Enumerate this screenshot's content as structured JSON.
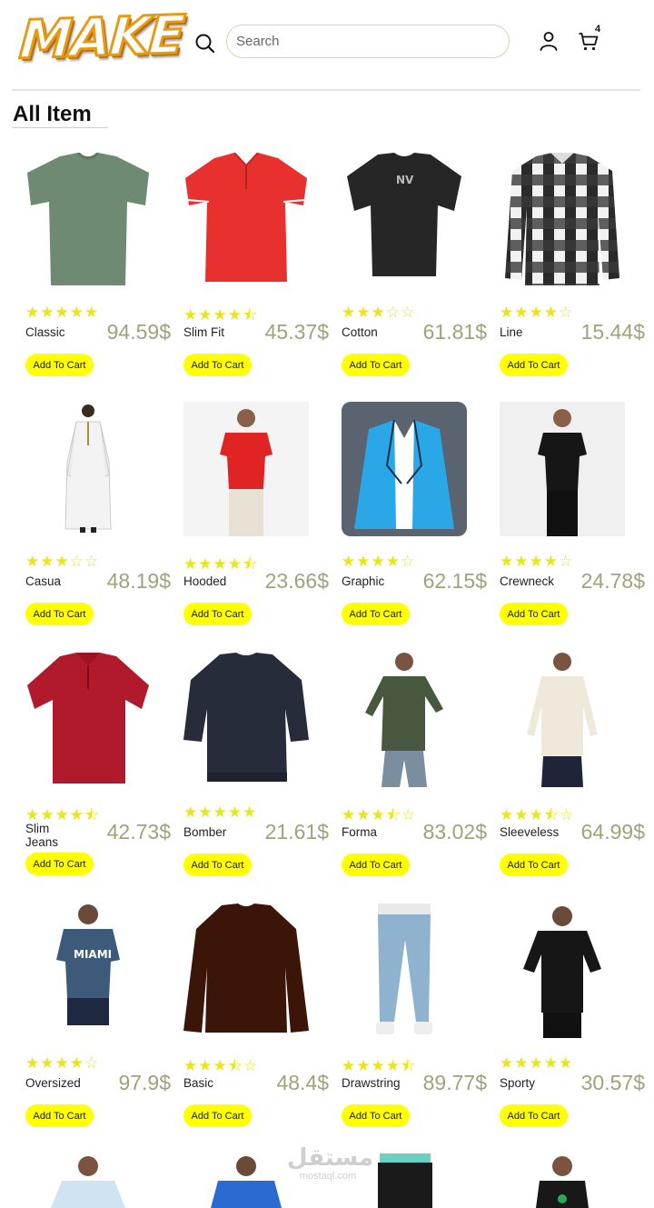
{
  "logo": {
    "text": "MAKE"
  },
  "header": {
    "search_placeholder": "Search",
    "cart_count": "4"
  },
  "section": {
    "title": "All Item"
  },
  "colors": {
    "accent_button": "#ffff00",
    "star": "#e6e619",
    "price": "#9fa27a"
  },
  "products": [
    {
      "name": "Classic",
      "price": "94.59$",
      "rating": 5,
      "button": "Add To Cart",
      "image": "green-tshirt"
    },
    {
      "name": "Slim Fit",
      "price": "45.37$",
      "rating": 4.5,
      "button": "Add To Cart",
      "image": "red-polo"
    },
    {
      "name": "Cotton",
      "price": "61.81$",
      "rating": 3,
      "button": "Add To Cart",
      "image": "black-oversize-tshirt"
    },
    {
      "name": "Line",
      "price": "15.44$",
      "rating": 4,
      "button": "Add To Cart",
      "image": "plaid-shirt"
    },
    {
      "name": "Casua",
      "price": "48.19$",
      "rating": 3,
      "button": "Add To Cart",
      "image": "white-thobe"
    },
    {
      "name": "Hooded",
      "price": "23.66$",
      "rating": 4.5,
      "button": "Add To Cart",
      "image": "man-red-polo"
    },
    {
      "name": "Graphic",
      "price": "62.15$",
      "rating": 4,
      "button": "Add To Cart",
      "image": "blue-blazer"
    },
    {
      "name": "Crewneck",
      "price": "24.78$",
      "rating": 4,
      "button": "Add To Cart",
      "image": "man-black-polo"
    },
    {
      "name": "Slim Jeans",
      "price": "42.73$",
      "rating": 4.5,
      "button": "Add To Cart",
      "image": "maroon-polo"
    },
    {
      "name": "Bomber",
      "price": "21.61$",
      "rating": 5,
      "button": "Add To Cart",
      "image": "navy-sweater"
    },
    {
      "name": "Forma",
      "price": "83.02$",
      "rating": 3.5,
      "button": "Add To Cart",
      "image": "man-green-sweater"
    },
    {
      "name": "Sleeveless",
      "price": "64.99$",
      "rating": 3.5,
      "button": "Add To Cart",
      "image": "man-cream-sweater"
    },
    {
      "name": "Oversized",
      "price": "97.9$",
      "rating": 4,
      "button": "Add To Cart",
      "image": "man-miami-tshirt"
    },
    {
      "name": "Basic",
      "price": "48.4$",
      "rating": 3.5,
      "button": "Add To Cart",
      "image": "brown-sweater"
    },
    {
      "name": "Drawstring",
      "price": "89.77$",
      "rating": 4.5,
      "button": "Add To Cart",
      "image": "blue-jeans"
    },
    {
      "name": "Sporty",
      "price": "30.57$",
      "rating": 5,
      "button": "Add To Cart",
      "image": "man-black-sport-tshirt"
    }
  ],
  "next_row_images": [
    "man-light-shirt",
    "man-blue-tshirt",
    "black-joggers",
    "man-black-tank"
  ],
  "watermark": {
    "arabic": "مستقل",
    "latin": "mostaql.com"
  }
}
